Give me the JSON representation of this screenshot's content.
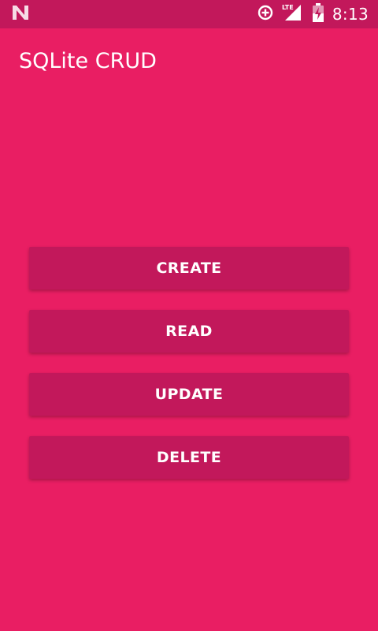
{
  "status_bar": {
    "time": "8:13",
    "network_label": "LTE",
    "icons": [
      "notification-n-icon",
      "data-saver-icon",
      "lte-signal-icon",
      "battery-icon"
    ]
  },
  "app_bar": {
    "title": "SQLite CRUD"
  },
  "buttons": {
    "create": "CREATE",
    "read": "READ",
    "update": "UPDATE",
    "delete": "DELETE"
  },
  "colors": {
    "background": "#e91e63",
    "status_bar": "#c2185b",
    "button": "#c2185b",
    "text": "#ffffff"
  }
}
